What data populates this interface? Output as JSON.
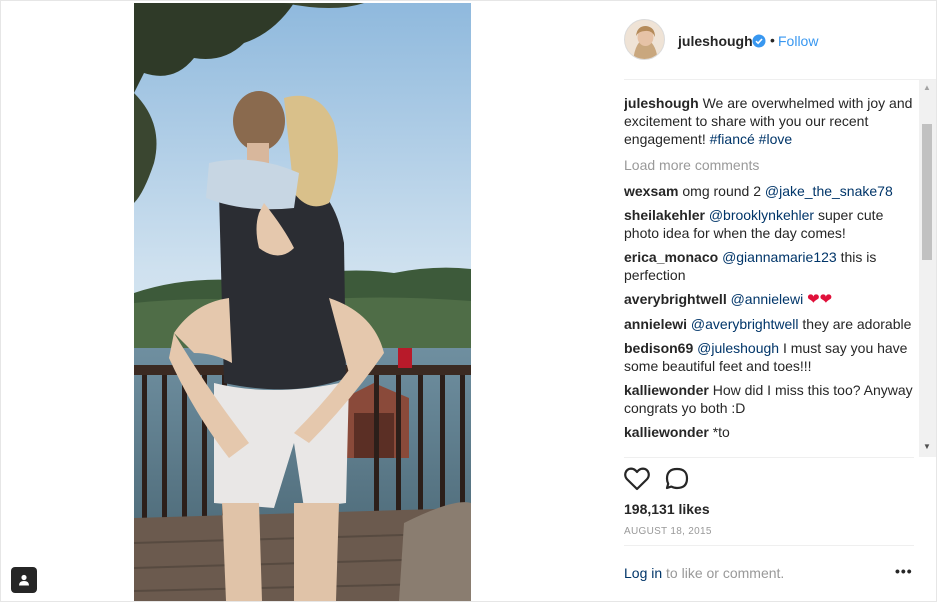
{
  "post": {
    "username": "juleshough",
    "follow_label": "Follow",
    "dot": "•",
    "caption": {
      "user": "juleshough",
      "text": "We are overwhelmed with joy and excitement to share with you our recent engagement!",
      "tag1": "#fiancé",
      "tag2": "#love"
    },
    "load_more": "Load more comments",
    "comments": [
      {
        "user": "wexsam",
        "pre": "omg round 2",
        "mention": "@jake_the_snake78",
        "post": ""
      },
      {
        "user": "sheilakehler",
        "pre": "",
        "mention": "@brooklynkehler",
        "post": "super cute photo idea for when the day comes!"
      },
      {
        "user": "erica_monaco",
        "pre": "",
        "mention": "@giannamarie123",
        "post": "this is perfection"
      },
      {
        "user": "averybrightwell",
        "pre": "",
        "mention": "@annielewi",
        "post": "❤❤"
      },
      {
        "user": "annielewi",
        "pre": "",
        "mention": "@averybrightwell",
        "post": "they are adorable"
      },
      {
        "user": "bedison69",
        "pre": "",
        "mention": "@juleshough",
        "post": "I must say you have some beautiful feet and toes!!!"
      },
      {
        "user": "kalliewonder",
        "pre": "How did I miss this too? Anyway congrats yo both :D",
        "mention": "",
        "post": ""
      },
      {
        "user": "kalliewonder",
        "pre": "*to",
        "mention": "",
        "post": ""
      }
    ],
    "likes": "198,131 likes",
    "date": "AUGUST 18, 2015",
    "login_link": "Log in",
    "login_text": " to like or comment.",
    "more": "•••"
  },
  "icons": {
    "like": "heart-outline-icon",
    "comment": "speech-bubble-icon",
    "verified": "verified-badge-icon",
    "tag": "user-tag-icon"
  },
  "colors": {
    "link_blue": "#3897f0",
    "mention_blue": "#003569",
    "muted": "#999999",
    "text": "#262626"
  }
}
